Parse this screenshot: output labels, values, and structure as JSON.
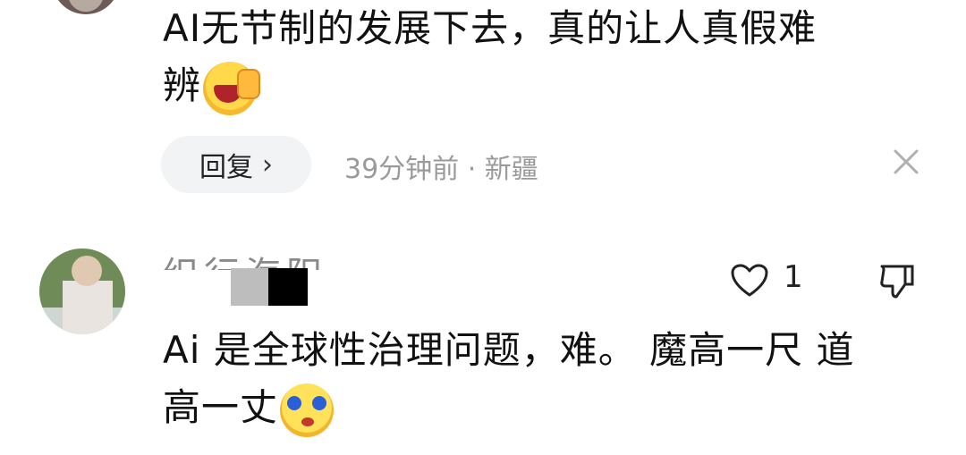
{
  "comments": [
    {
      "text_line1": "AI无节制的发展下去，真的让人真假难",
      "text_line2": "辨",
      "emoji": "laugh-cry-emoji",
      "reply_label": "回复",
      "reply_chevron": "›",
      "meta": "39分钟前 · 新疆"
    },
    {
      "username": "织行海阳",
      "likes": "1",
      "text_line1": "Ai 是全球性治理问题，难。 魔高一尺 道",
      "text_line2": "高一丈",
      "emoji": "teary-face-emoji"
    }
  ],
  "icons": {
    "close": "close-icon",
    "like": "heart-outline-icon",
    "dislike": "thumbs-down-icon"
  },
  "colors": {
    "text": "#111111",
    "meta": "#9a9a9a",
    "pill_bg": "#f2f3f5",
    "background": "#ffffff"
  }
}
